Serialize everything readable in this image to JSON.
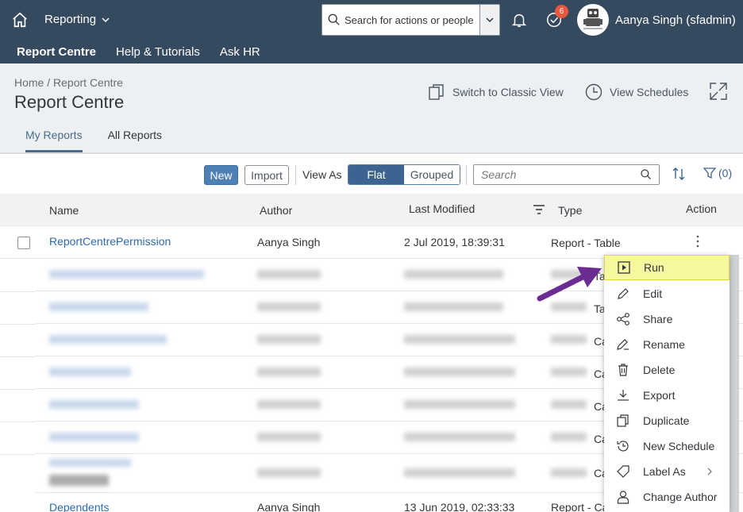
{
  "shell": {
    "module": "Reporting",
    "search_placeholder": "Search for actions or people",
    "notification_badge": "6",
    "user": "Aanya Singh (sfadmin)"
  },
  "subnav": [
    "Report Centre",
    "Help & Tutorials",
    "Ask HR"
  ],
  "header": {
    "breadcrumb_home": "Home",
    "breadcrumb_sep": "/",
    "breadcrumb_current": "Report Centre",
    "title": "Report Centre",
    "classic_view": "Switch to Classic View",
    "view_schedules": "View Schedules"
  },
  "tabs": [
    "My Reports",
    "All Reports"
  ],
  "toolbar": {
    "new": "New",
    "import": "Import",
    "view_as": "View As",
    "flat": "Flat",
    "grouped": "Grouped",
    "search_placeholder": "Search",
    "filter_count": "(0)"
  },
  "table": {
    "columns": {
      "name": "Name",
      "author": "Author",
      "last_modified": "Last Modified",
      "type": "Type",
      "action": "Action"
    },
    "row1": {
      "name": "ReportCentrePermission",
      "author": "Aanya Singh",
      "modified": "2 Jul 2019, 18:39:31",
      "type": "Report - Table"
    },
    "partial_types": [
      "Ta",
      "Ta",
      "Ca",
      "Ca",
      "Ca",
      "Ca",
      "Ca"
    ],
    "last_row": {
      "name": "Dependents",
      "author": "Aanya Singh",
      "modified": "13 Jun 2019, 02:33:33",
      "type": "Report - Canvas"
    }
  },
  "menu": [
    "Run",
    "Edit",
    "Share",
    "Rename",
    "Delete",
    "Export",
    "Duplicate",
    "New Schedule",
    "Label As",
    "Change Author"
  ]
}
